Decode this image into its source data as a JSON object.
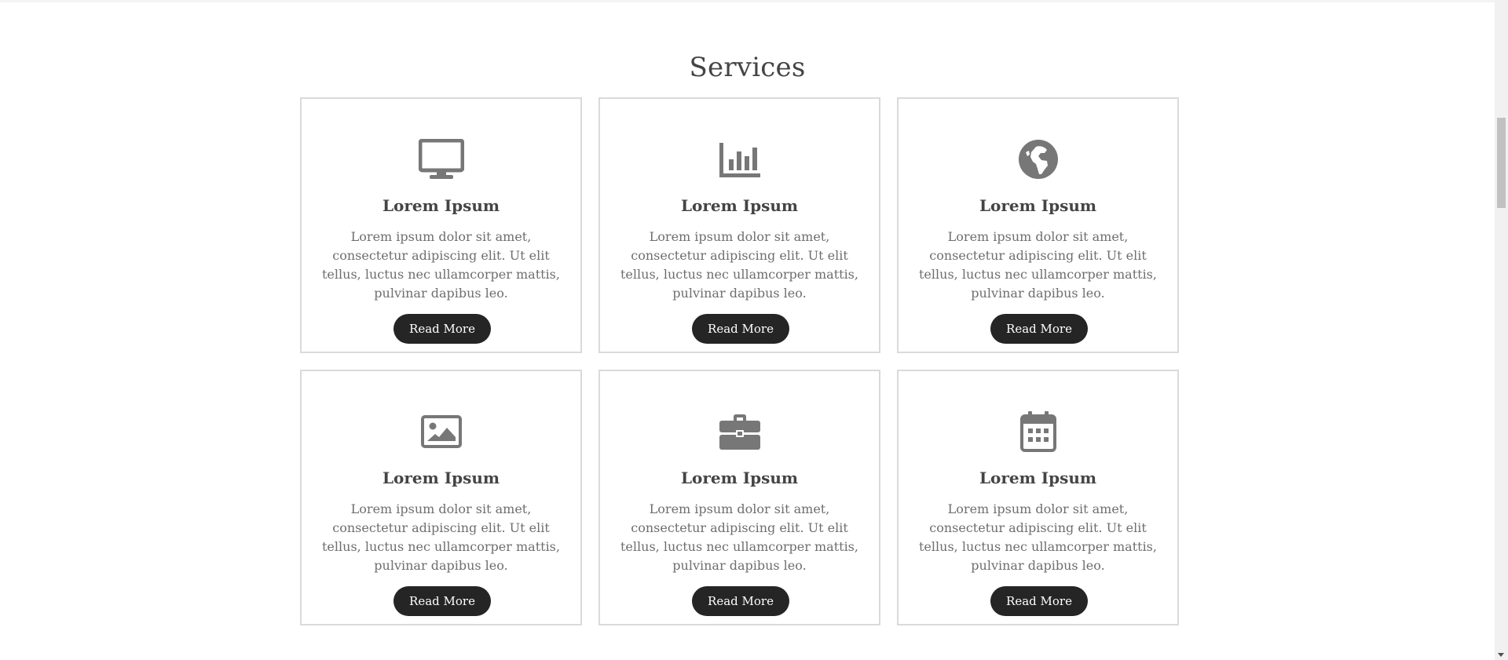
{
  "section": {
    "title": "Services"
  },
  "icon_color": "#777777",
  "button_color": "#252525",
  "cards": [
    {
      "icon": "monitor-icon",
      "title": "Lorem Ipsum",
      "text": "Lorem ipsum dolor sit amet, consectetur adipiscing elit. Ut elit tellus, luctus nec ullamcorper mattis, pulvinar dapibus leo.",
      "button": "Read More"
    },
    {
      "icon": "bar-chart-icon",
      "title": "Lorem Ipsum",
      "text": "Lorem ipsum dolor sit amet, consectetur adipiscing elit. Ut elit tellus, luctus nec ullamcorper mattis, pulvinar dapibus leo.",
      "button": "Read More"
    },
    {
      "icon": "globe-icon",
      "title": "Lorem Ipsum",
      "text": "Lorem ipsum dolor sit amet, consectetur adipiscing elit. Ut elit tellus, luctus nec ullamcorper mattis, pulvinar dapibus leo.",
      "button": "Read More"
    },
    {
      "icon": "image-icon",
      "title": "Lorem Ipsum",
      "text": "Lorem ipsum dolor sit amet, consectetur adipiscing elit. Ut elit tellus, luctus nec ullamcorper mattis, pulvinar dapibus leo.",
      "button": "Read More"
    },
    {
      "icon": "briefcase-icon",
      "title": "Lorem Ipsum",
      "text": "Lorem ipsum dolor sit amet, consectetur adipiscing elit. Ut elit tellus, luctus nec ullamcorper mattis, pulvinar dapibus leo.",
      "button": "Read More"
    },
    {
      "icon": "calendar-icon",
      "title": "Lorem Ipsum",
      "text": "Lorem ipsum dolor sit amet, consectetur adipiscing elit. Ut elit tellus, luctus nec ullamcorper mattis, pulvinar dapibus leo.",
      "button": "Read More"
    }
  ]
}
